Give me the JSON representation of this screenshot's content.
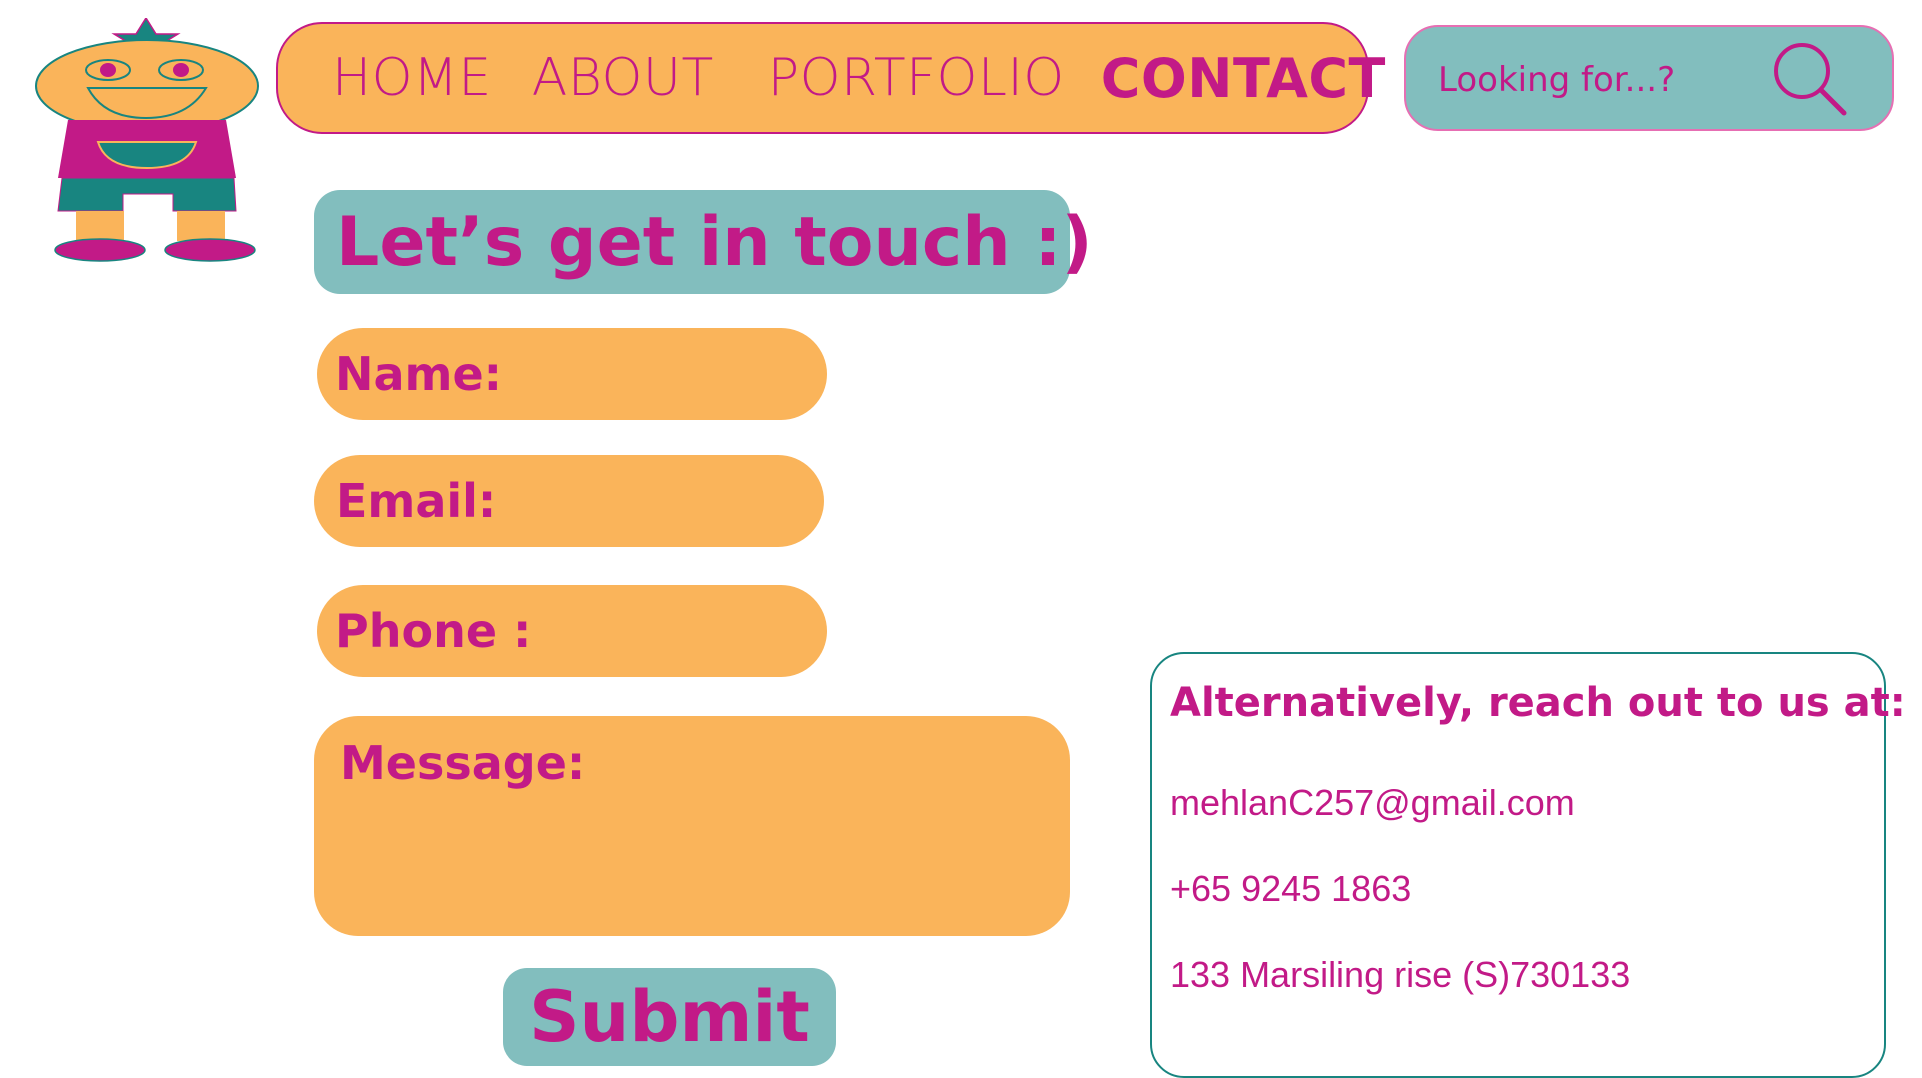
{
  "nav": {
    "items": [
      {
        "label": "HOME"
      },
      {
        "label": "ABOUT"
      },
      {
        "label": "PORTFOLIO"
      },
      {
        "label": "CONTACT",
        "active": true
      }
    ]
  },
  "search": {
    "placeholder": "Looking for...?",
    "icon": "search-icon"
  },
  "form": {
    "heading": "Let’s get in touch :)",
    "name_label": "Name:",
    "email_label": "Email:",
    "phone_label": "Phone :",
    "message_label": "Message:",
    "submit_label": "Submit"
  },
  "contact": {
    "title": "Alternatively, reach out to us at:",
    "email": "mehlanC257@gmail.com",
    "phone": "+65 9245 1863",
    "address": "133 Marsiling rise (S)730133"
  },
  "colors": {
    "magenta": "#c21a87",
    "orange": "#fab45a",
    "teal": "#82bebe",
    "dark_teal": "#188580",
    "pink_border": "#e66fb3"
  }
}
